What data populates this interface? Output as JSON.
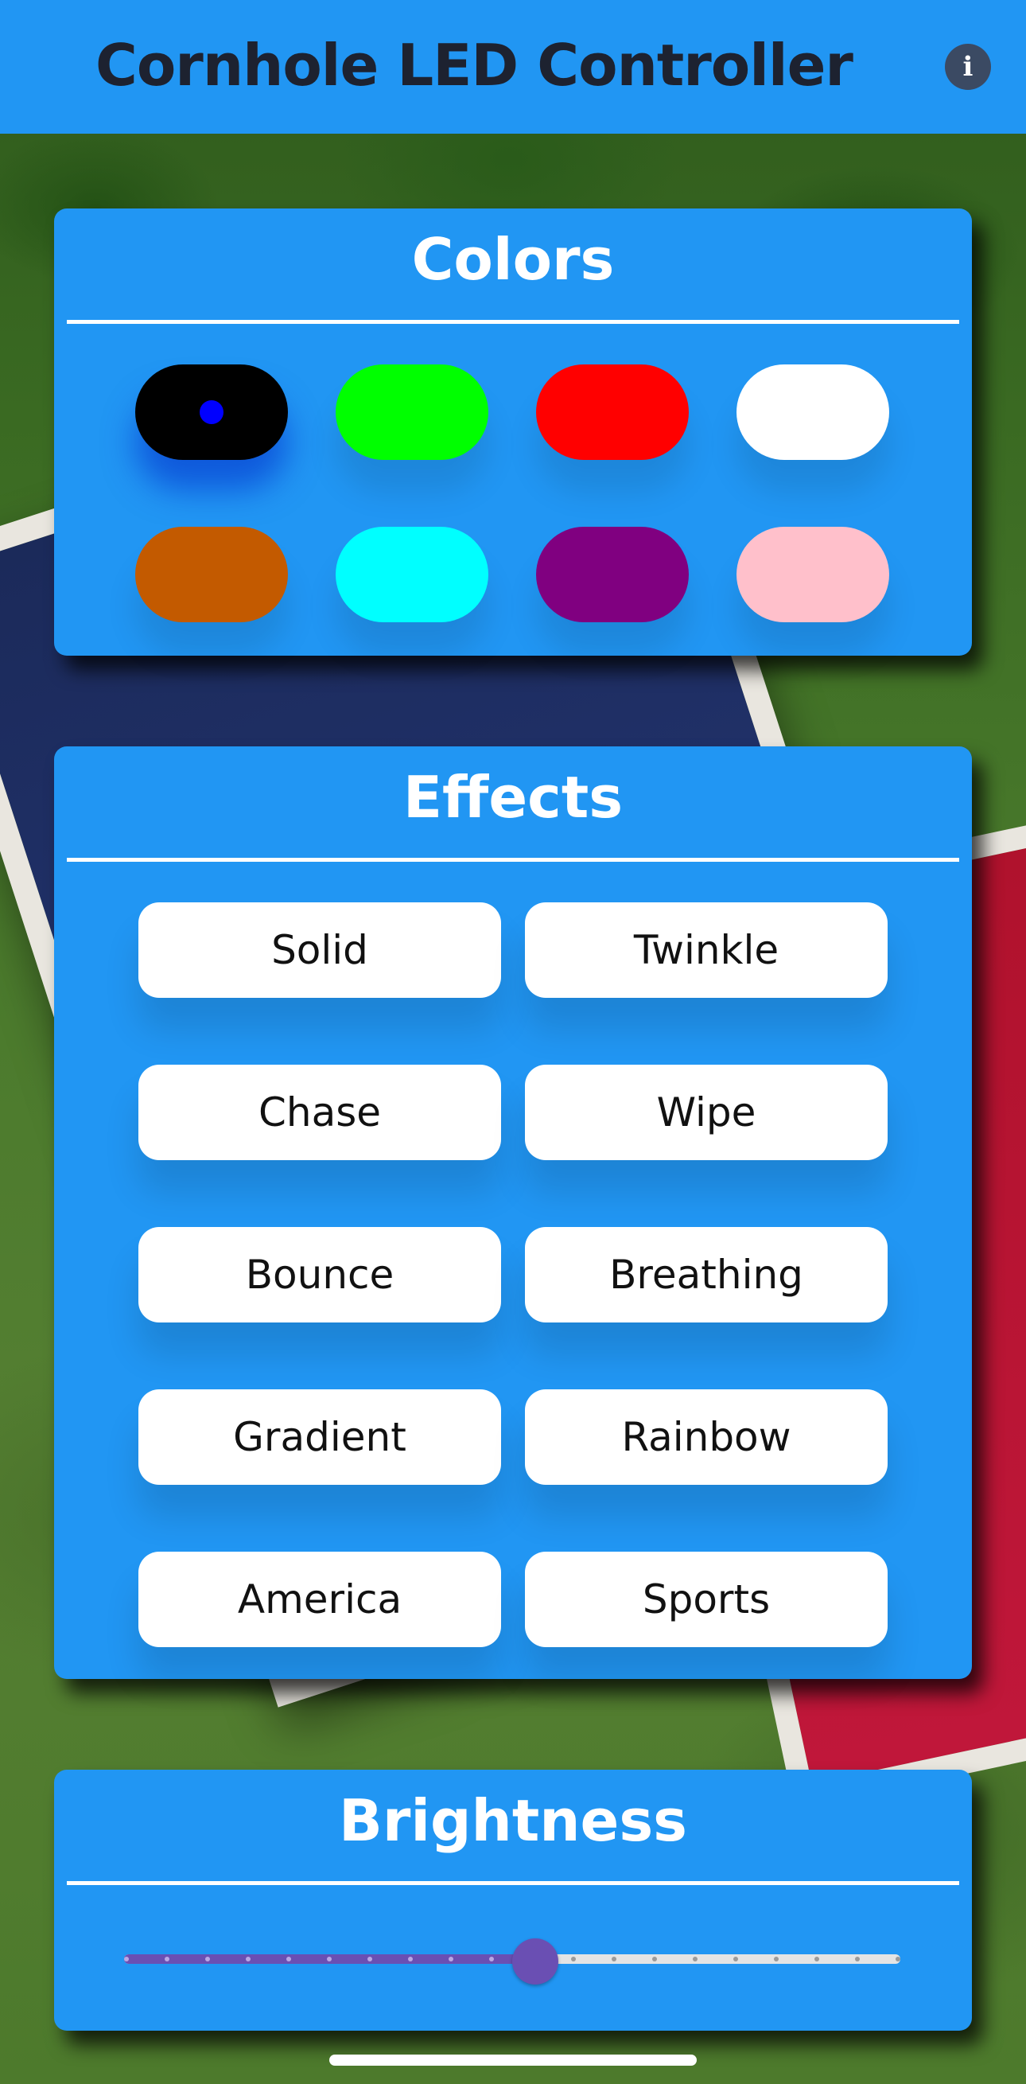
{
  "header": {
    "title": "Cornhole LED Controller",
    "info_icon": "info-icon",
    "info_glyph": "i",
    "background_color": "#2196f3"
  },
  "colors_card": {
    "title": "Colors",
    "swatches": [
      {
        "name": "black",
        "color": "#000000",
        "selected": true,
        "selected_dot_color": "#0000ff"
      },
      {
        "name": "green",
        "color": "#00ff00",
        "selected": false
      },
      {
        "name": "red",
        "color": "#ff0000",
        "selected": false
      },
      {
        "name": "white",
        "color": "#ffffff",
        "selected": false
      },
      {
        "name": "orange",
        "color": "#c35a00",
        "selected": false
      },
      {
        "name": "cyan",
        "color": "#00ffff",
        "selected": false
      },
      {
        "name": "purple",
        "color": "#800080",
        "selected": false
      },
      {
        "name": "pink",
        "color": "#ffc0cb",
        "selected": false
      }
    ]
  },
  "effects_card": {
    "title": "Effects",
    "buttons": [
      "Solid",
      "Twinkle",
      "Chase",
      "Wipe",
      "Bounce",
      "Breathing",
      "Gradient",
      "Rainbow",
      "America",
      "Sports"
    ]
  },
  "brightness_card": {
    "title": "Brightness",
    "value_fraction": 0.53,
    "tick_count": 20,
    "accent_color": "#6a4fb3"
  }
}
